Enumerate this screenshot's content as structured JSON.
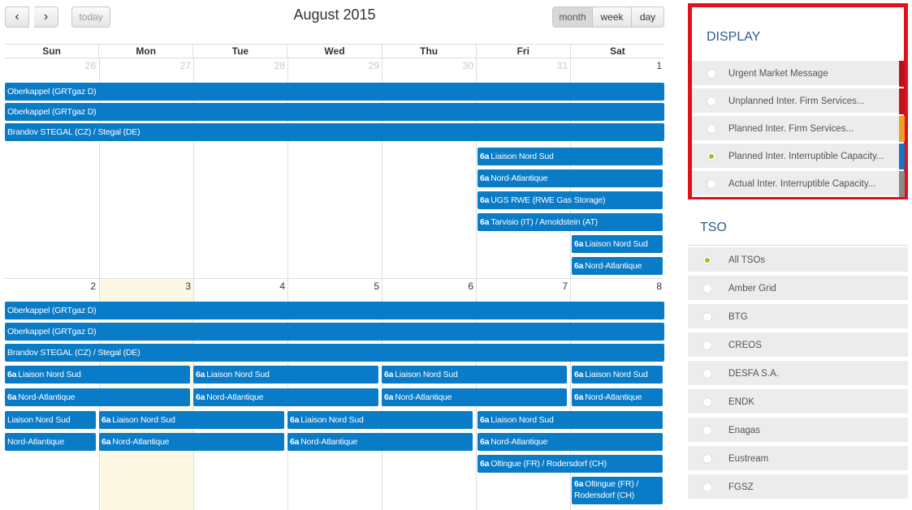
{
  "toolbar": {
    "prev": "‹",
    "next": "›",
    "today": "today",
    "title": "August 2015",
    "views": [
      "month",
      "week",
      "day"
    ]
  },
  "dow": [
    "Sun",
    "Mon",
    "Tue",
    "Wed",
    "Thu",
    "Fri",
    "Sat"
  ],
  "week1": {
    "days": [
      "26",
      "27",
      "28",
      "29",
      "30",
      "31",
      "1"
    ],
    "events": {
      "e1": "Oberkappel (GRTgaz D)",
      "e2": "Oberkappel (GRTgaz D)",
      "e3": "Brandov STEGAL (CZ) / Stegal (DE)",
      "e4": "Liaison Nord Sud",
      "e5": "Nord-Atlantique",
      "e6": "UGS RWE (RWE Gas Storage)",
      "e7": "Tarvisio (IT) / Arnoldstein (AT)",
      "e8": "Liaison Nord Sud",
      "e9": "Nord-Atlantique"
    }
  },
  "week2": {
    "days": [
      "2",
      "3",
      "4",
      "5",
      "6",
      "7",
      "8"
    ],
    "events": {
      "e1": "Oberkappel (GRTgaz D)",
      "e2": "Oberkappel (GRTgaz D)",
      "e3": "Brandov STEGAL (CZ) / Stegal (DE)",
      "r4a": "Liaison Nord Sud",
      "r4b": "Liaison Nord Sud",
      "r4c": "Liaison Nord Sud",
      "r4d": "Liaison Nord Sud",
      "r5a": "Nord-Atlantique",
      "r5b": "Nord-Atlantique",
      "r5c": "Nord-Atlantique",
      "r5d": "Nord-Atlantique",
      "r6a": "Liaison Nord Sud",
      "r6b": "Liaison Nord Sud",
      "r6c": "Liaison Nord Sud",
      "r6d": "Liaison Nord Sud",
      "r7a": "Nord-Atlantique",
      "r7b": "Nord-Atlantique",
      "r7c": "Nord-Atlantique",
      "r7d": "Nord-Atlantique",
      "r8": "Oltingue (FR) / Rodersdorf (CH)",
      "r9": "Oltingue (FR) / Rodersdorf (CH)"
    }
  },
  "event_prefix": "6a",
  "colors": {
    "event": "#0a7bc6",
    "highlight_border": "#e3101c",
    "radio_selected": "#9bc32e",
    "swatch_urgent": "#b5121b",
    "swatch_unplanned": "#c0141c",
    "swatch_planned_firm": "#f0a01e",
    "swatch_planned_interruptible": "#1a73c0",
    "swatch_actual": "#8a8a8a"
  },
  "display": {
    "title": "DISPLAY",
    "items": [
      "Urgent Market Message",
      "Unplanned Inter. Firm Services...",
      "Planned Inter. Firm Services...",
      "Planned Inter. Interruptible Capacity...",
      "Actual Inter. Interruptible Capacity..."
    ],
    "selected_index": 3
  },
  "tso": {
    "title": "TSO",
    "items": [
      "All TSOs",
      "Amber Grid",
      "BTG",
      "CREOS",
      "DESFA S.A.",
      "ENDK",
      "Enagas",
      "Eustream",
      "FGSZ"
    ],
    "selected_index": 0
  }
}
